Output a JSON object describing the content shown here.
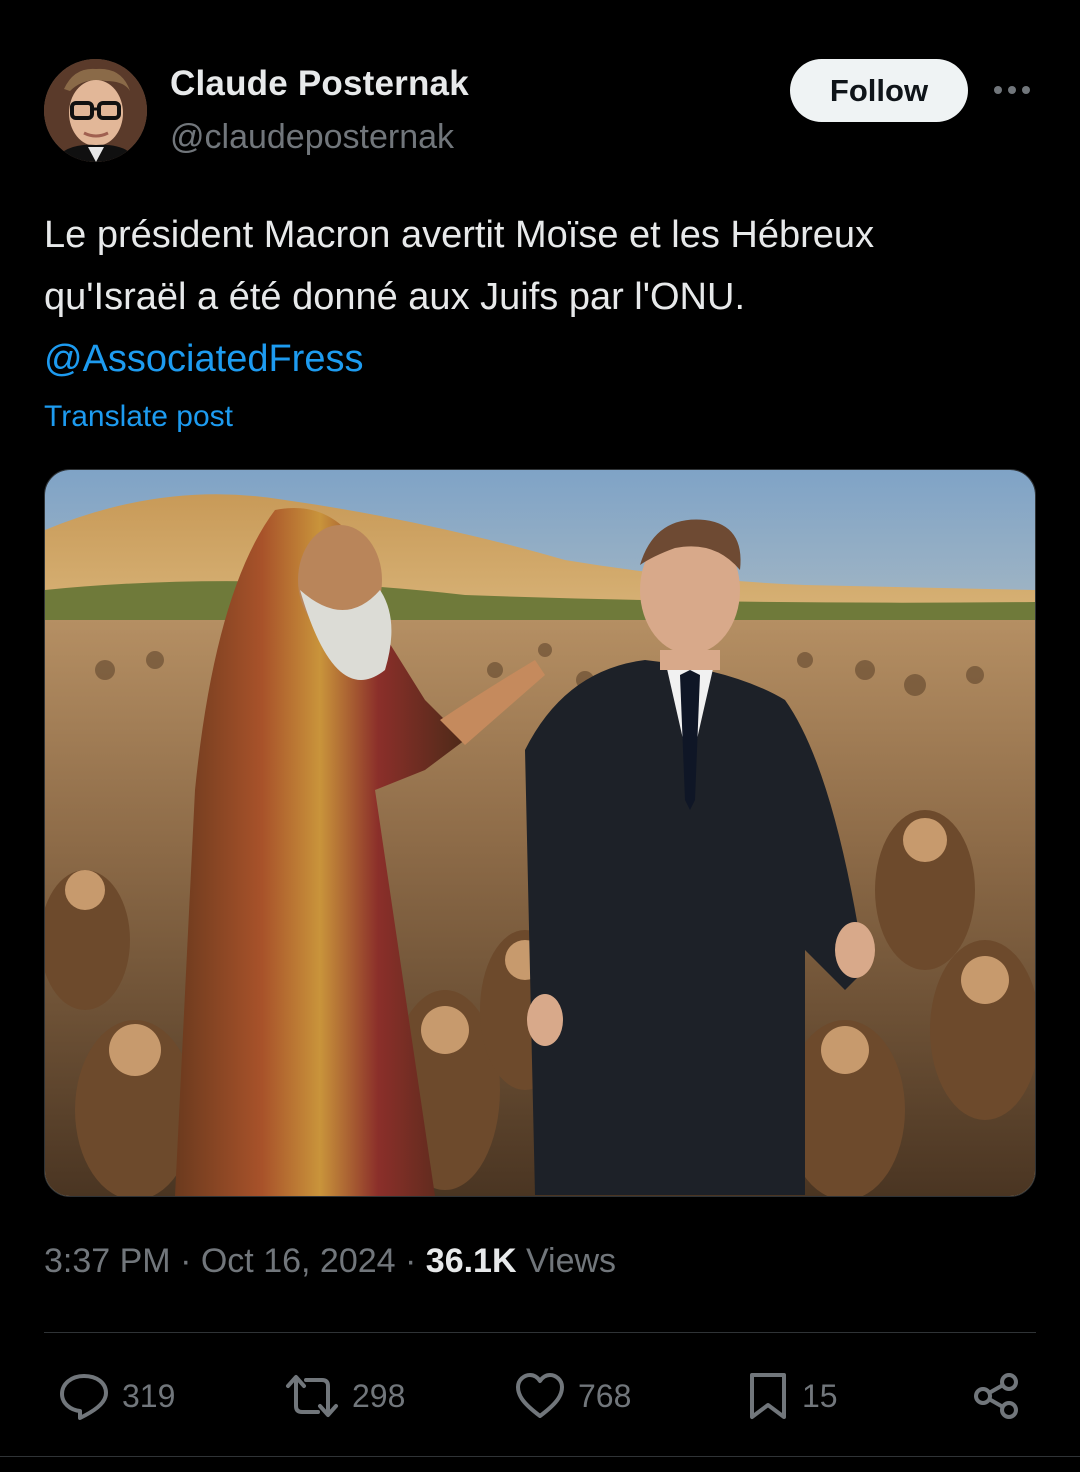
{
  "author": {
    "display_name": "Claude Posternak",
    "handle": "@claudeposternak"
  },
  "follow_label": "Follow",
  "post": {
    "text_line1": "Le président Macron avertit Moïse et les Hébreux",
    "text_line2": "qu'Israël a été donné aux Juifs par l'ONU.",
    "mention": "@AssociatedFress",
    "translate_label": "Translate post"
  },
  "meta": {
    "time": "3:37 PM",
    "separator": "·",
    "date": "Oct 16, 2024",
    "views_count": "36.1K",
    "views_label": "Views"
  },
  "actions": {
    "replies": "319",
    "reposts": "298",
    "likes": "768",
    "bookmarks": "15"
  },
  "colors": {
    "background": "#000000",
    "text_primary": "#e7e9ea",
    "text_secondary": "#71767b",
    "link": "#1d9bf0",
    "follow_button_bg": "#eff3f4"
  },
  "icons": [
    "more-icon",
    "reply-icon",
    "repost-icon",
    "like-icon",
    "bookmark-icon",
    "share-icon"
  ]
}
